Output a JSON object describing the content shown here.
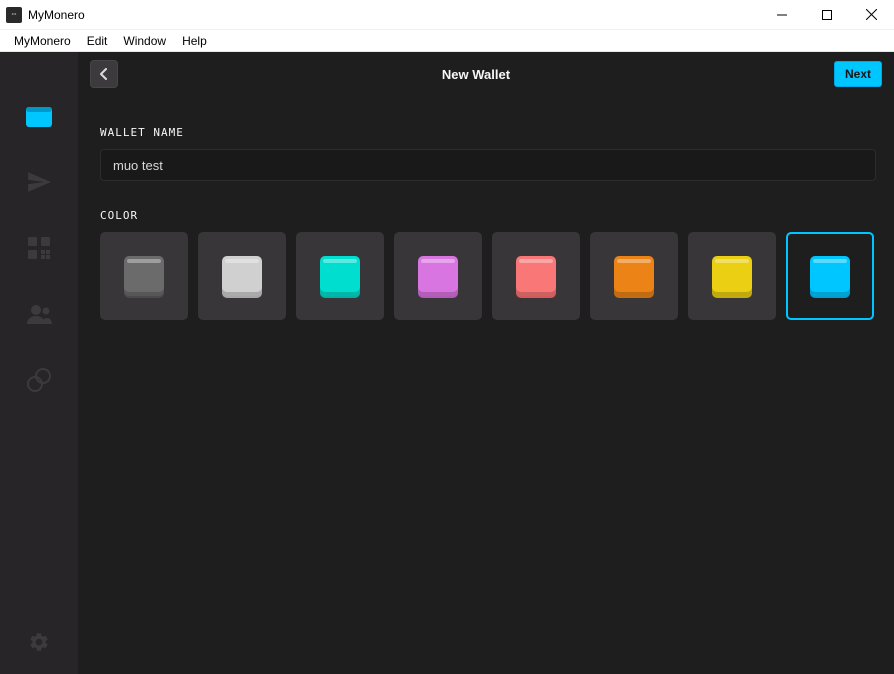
{
  "window": {
    "title": "MyMonero"
  },
  "menu": {
    "items": [
      "MyMonero",
      "Edit",
      "Window",
      "Help"
    ]
  },
  "sidebar": {
    "icons": [
      "wallet",
      "send",
      "qr",
      "contacts",
      "exchange"
    ],
    "active_index": 0,
    "settings": "settings"
  },
  "topbar": {
    "title": "New Wallet",
    "next_label": "Next"
  },
  "form": {
    "wallet_name_label": "WALLET NAME",
    "wallet_name_value": "muo test",
    "color_label": "COLOR",
    "colors": [
      {
        "name": "dark-gray",
        "hex": "#6b6b6b",
        "shadow": "#4a4a4a"
      },
      {
        "name": "light-gray",
        "hex": "#d0d0d0",
        "shadow": "#a6a6a6"
      },
      {
        "name": "teal",
        "hex": "#00decf",
        "shadow": "#00b0a4"
      },
      {
        "name": "magenta",
        "hex": "#d975e1",
        "shadow": "#b158b8"
      },
      {
        "name": "coral",
        "hex": "#f97777",
        "shadow": "#d65858"
      },
      {
        "name": "orange",
        "hex": "#eb8316",
        "shadow": "#c46c10"
      },
      {
        "name": "yellow",
        "hex": "#eacf12",
        "shadow": "#c3ab0c"
      },
      {
        "name": "cyan",
        "hex": "#00c6ff",
        "shadow": "#009ed0"
      }
    ],
    "selected_color_index": 7
  }
}
